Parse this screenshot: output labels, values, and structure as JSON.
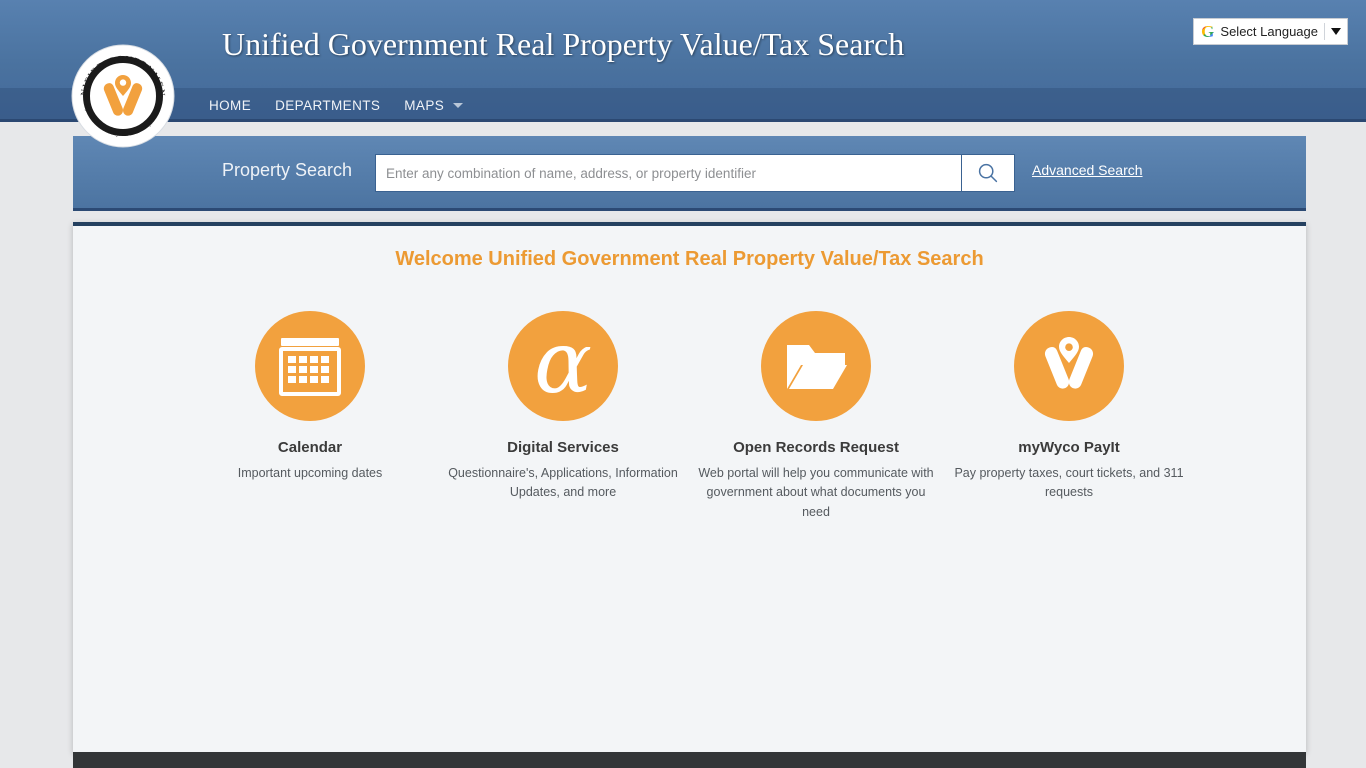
{
  "header": {
    "site_title": "Unified Government Real Property Value/Tax Search",
    "logo": {
      "name": "unified-government-seal",
      "arc_top_text": "UNIFIED GOVERNMENT",
      "arc_bottom_text": "Wyandotte County•Kansas City, Kansas"
    },
    "nav": [
      {
        "label": "HOME",
        "icon": "",
        "has_dropdown": false
      },
      {
        "label": "DEPARTMENTS",
        "icon": "",
        "has_dropdown": false
      },
      {
        "label": "MAPS",
        "icon": "chevron-down-icon",
        "has_dropdown": true
      }
    ],
    "translate": {
      "logo_letter": "G",
      "label": "Select Language",
      "arrow_icon": "triangle-down-icon"
    }
  },
  "search": {
    "label": "Property Search",
    "placeholder": "Enter any combination of name, address, or property identifier",
    "value": "",
    "button_icon": "search-icon",
    "advanced_link": "Advanced Search"
  },
  "main": {
    "welcome_heading": "Welcome Unified Government Real Property Value/Tax Search",
    "tiles": [
      {
        "icon": "calendar-icon",
        "title": "Calendar",
        "description": "Important upcoming dates"
      },
      {
        "icon": "alpha-icon",
        "glyph": "α",
        "title": "Digital Services",
        "description": "Questionnaire's, Applications, Information Updates, and more"
      },
      {
        "icon": "open-folder-icon",
        "title": "Open Records Request",
        "description": "Web portal will help you communicate with government about what documents you need"
      },
      {
        "icon": "wyco-w-logo-icon",
        "title": "myWyco PayIt",
        "description": "Pay property taxes, court tickets, and 311 requests"
      }
    ]
  },
  "colors": {
    "header_blue_top": "#5881b0",
    "header_blue_bottom": "#43699a",
    "accent_orange": "#f2a13e",
    "heading_orange": "#ec9a33",
    "panel_bg": "#f3f5f7",
    "footer_dark": "#333638",
    "page_bg": "#e7e8ea"
  }
}
